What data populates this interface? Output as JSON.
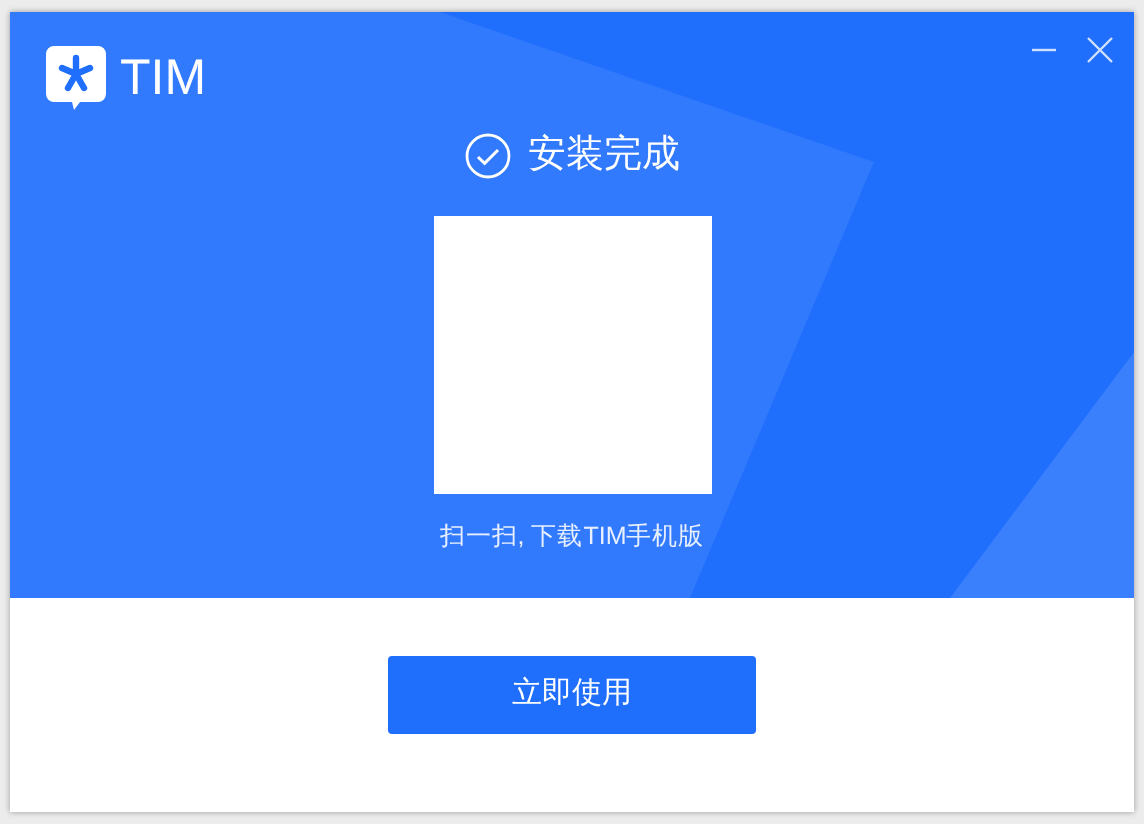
{
  "window": {
    "app_name": "TIM",
    "controls": [
      {
        "kind": "minimize"
      },
      {
        "kind": "close"
      }
    ]
  },
  "status": {
    "title": "安装完成"
  },
  "qr": {
    "caption": "扫一扫, 下载TIM手机版"
  },
  "primary_button": {
    "label": "立即使用"
  }
}
